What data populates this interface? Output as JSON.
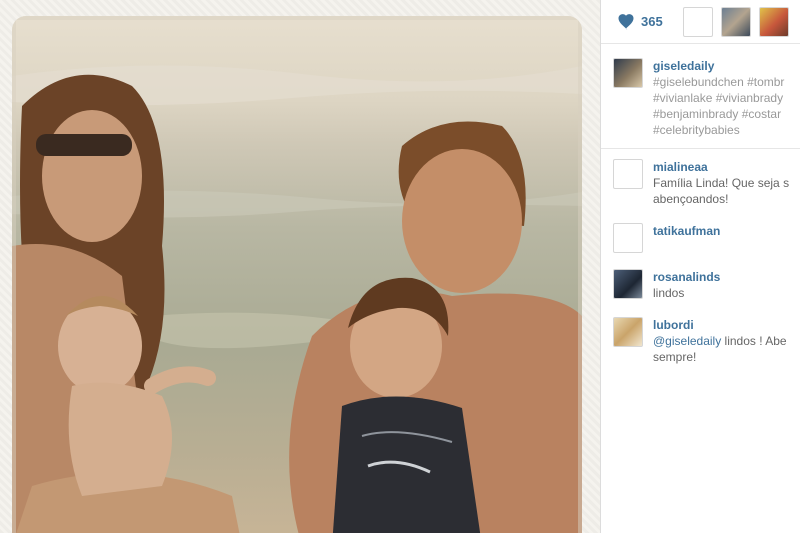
{
  "likes": {
    "icon": "heart-icon",
    "count": "365"
  },
  "caption": {
    "username": "giseledaily",
    "hashtags": [
      "#giselebundchen",
      "#tombrady",
      "#vivianlake",
      "#vivianbrady",
      "#benjaminbrady",
      "#costarica",
      "#celebritybabies"
    ],
    "lines": [
      "#giselebundchen #tombr",
      "#vivianlake #vivianbrady",
      "#benjaminbrady #costar",
      "#celebritybabies"
    ]
  },
  "comments": [
    {
      "username": "mialineaa",
      "text": "Família Linda! Que seja s",
      "text2": "abençoandos!"
    },
    {
      "username": "tatikaufman",
      "text": ""
    },
    {
      "username": "rosanalinds",
      "text": "lindos"
    },
    {
      "username": "lubordi",
      "mention": "@giseledaily",
      "text": " lindos ! Abe",
      "text2": "sempre!"
    }
  ],
  "colors": {
    "accent": "#3f729b",
    "muted": "#999999",
    "border": "#dcdcdc"
  }
}
